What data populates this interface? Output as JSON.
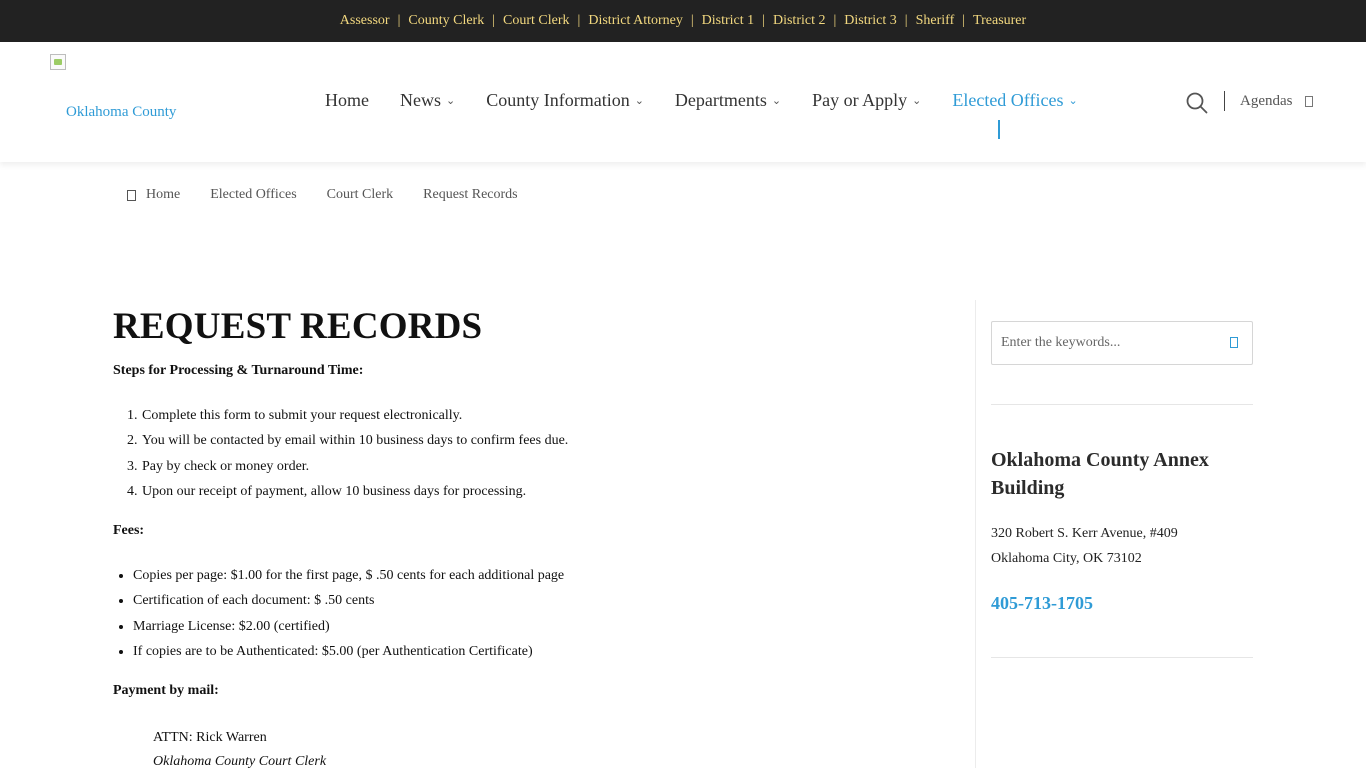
{
  "topbar": {
    "links": [
      "Assessor",
      "County Clerk",
      "Court Clerk",
      "District Attorney",
      "District 1",
      "District 2",
      "District 3",
      "Sheriff",
      "Treasurer"
    ]
  },
  "header": {
    "logo_text": "Oklahoma County",
    "nav": [
      {
        "label": "Home",
        "dropdown": false,
        "active": false
      },
      {
        "label": "News",
        "dropdown": true,
        "active": false
      },
      {
        "label": "County Information",
        "dropdown": true,
        "active": false
      },
      {
        "label": "Departments",
        "dropdown": true,
        "active": false
      },
      {
        "label": "Pay or Apply",
        "dropdown": true,
        "active": false
      },
      {
        "label": "Elected Offices",
        "dropdown": true,
        "active": true
      }
    ],
    "agendas_label": "Agendas",
    "search_icon": "search-icon"
  },
  "breadcrumb": [
    "Home",
    "Elected Offices",
    "Court Clerk",
    "Request Records"
  ],
  "main": {
    "title": "REQUEST RECORDS",
    "steps_heading": "Steps for Processing & Turnaround Time:",
    "steps": [
      "Complete this form to submit your request electronically.",
      "You will be contacted by email within 10 business days to confirm fees due.",
      "Pay by check or money order.",
      "Upon our receipt of payment, allow 10 business days for processing."
    ],
    "fees_heading": "Fees:",
    "fees": [
      "Copies per page: $1.00 for the first page, $ .50 cents for each additional page",
      "Certification of each document: $ .50 cents",
      "Marriage License: $2.00 (certified)",
      "If copies are to be Authenticated: $5.00 (per Authentication Certificate)"
    ],
    "mail_heading": "Payment by mail:",
    "attn": "ATTN: Rick Warren",
    "office": "Oklahoma County Court Clerk"
  },
  "sidebar": {
    "search_placeholder": "Enter the keywords...",
    "building_title": "Oklahoma County Annex Building",
    "address_line1": "320 Robert S. Kerr Avenue, #409",
    "address_line2": "Oklahoma City, OK 73102",
    "phone": "405-713-1705"
  },
  "colors": {
    "accent": "#2f9bd6",
    "topbar_bg": "#222222",
    "topbar_link": "#f2d87f"
  }
}
